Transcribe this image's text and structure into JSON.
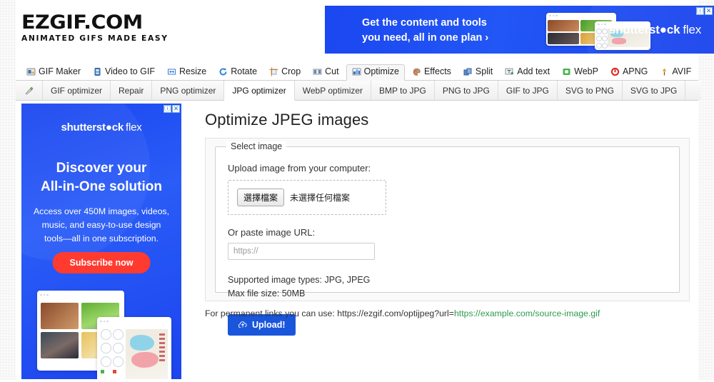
{
  "site": {
    "logo_primary": "EZGIF.COM",
    "logo_tagline": "ANIMATED GIFS MADE EASY"
  },
  "top_ad": {
    "headline_line1": "Get the content and tools",
    "headline_line2": "you need, all in one plan  ›",
    "brand_bold": "shutterst●ck",
    "brand_light": "flex",
    "info_glyph": "ⓘ",
    "close_glyph": "✕"
  },
  "sidebar_ad": {
    "brand_bold": "shutterst●ck",
    "brand_light": "flex",
    "headline_line1": "Discover your",
    "headline_line2": "All-in-One solution",
    "subtext": "Access over 450M images, videos, music, and easy-to-use design tools—all in one subscription.",
    "cta_label": "Subscribe now",
    "info_glyph": "ⓘ",
    "close_glyph": "✕"
  },
  "main_nav": {
    "items": [
      {
        "label": "GIF Maker",
        "icon": "gif-maker-icon",
        "active": false
      },
      {
        "label": "Video to GIF",
        "icon": "video-to-gif-icon",
        "active": false
      },
      {
        "label": "Resize",
        "icon": "resize-icon",
        "active": false
      },
      {
        "label": "Rotate",
        "icon": "rotate-icon",
        "active": false
      },
      {
        "label": "Crop",
        "icon": "crop-icon",
        "active": false
      },
      {
        "label": "Cut",
        "icon": "cut-icon",
        "active": false
      },
      {
        "label": "Optimize",
        "icon": "optimize-icon",
        "active": true
      },
      {
        "label": "Effects",
        "icon": "effects-icon",
        "active": false
      },
      {
        "label": "Split",
        "icon": "split-icon",
        "active": false
      },
      {
        "label": "Add text",
        "icon": "add-text-icon",
        "active": false
      },
      {
        "label": "WebP",
        "icon": "webp-icon",
        "active": false
      },
      {
        "label": "APNG",
        "icon": "apng-icon",
        "active": false
      },
      {
        "label": "AVIF",
        "icon": "avif-icon",
        "active": false
      }
    ]
  },
  "sub_nav": {
    "home_icon": "home-icon",
    "items": [
      {
        "label": "GIF optimizer",
        "active": false
      },
      {
        "label": "Repair",
        "active": false
      },
      {
        "label": "PNG optimizer",
        "active": false
      },
      {
        "label": "JPG optimizer",
        "active": true
      },
      {
        "label": "WebP optimizer",
        "active": false
      },
      {
        "label": "BMP to JPG",
        "active": false
      },
      {
        "label": "PNG to JPG",
        "active": false
      },
      {
        "label": "GIF to JPG",
        "active": false
      },
      {
        "label": "SVG to PNG",
        "active": false
      },
      {
        "label": "SVG to JPG",
        "active": false
      }
    ]
  },
  "main": {
    "title": "Optimize JPEG images",
    "fieldset_legend": "Select image",
    "upload_label": "Upload image from your computer:",
    "file_button_label": "選擇檔案",
    "file_name_label": "未選擇任何檔案",
    "url_label": "Or paste image URL:",
    "url_value": "",
    "url_placeholder": "https://",
    "supported_types": "Supported image types: JPG, JPEG",
    "max_file_size": "Max file size: 50MB",
    "upload_button_label": "Upload!",
    "upload_icon": "cloud-upload-icon",
    "permalink_prefix": "For permanent links you can use: https://ezgif.com/optijpeg?url=",
    "permalink_example": "https://example.com/source-image.gif"
  },
  "colors": {
    "ad_blue": "#1b47f0",
    "cta_red": "#ff3b30",
    "upload_blue": "#1a56db",
    "link_green": "#2e9b4f"
  }
}
